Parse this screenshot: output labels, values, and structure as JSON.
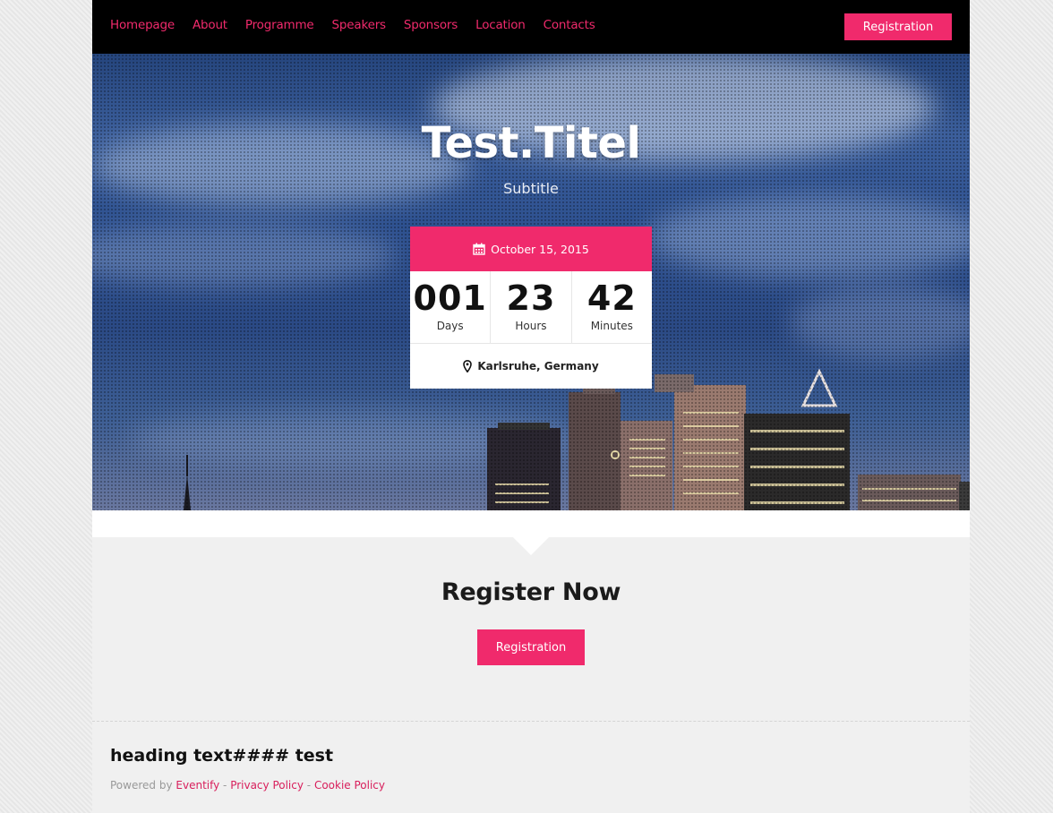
{
  "colors": {
    "accent": "#f02a6c",
    "nav_bg": "#000000"
  },
  "nav": {
    "links": [
      "Homepage",
      "About",
      "Programme",
      "Speakers",
      "Sponsors",
      "Location",
      "Contacts"
    ],
    "registration_label": "Registration"
  },
  "hero": {
    "title": "Test.Titel",
    "subtitle": "Subtitle"
  },
  "countdown": {
    "date_icon": "calendar-icon",
    "date": "October 15, 2015",
    "units": [
      {
        "value": "001",
        "label": "Days"
      },
      {
        "value": "23",
        "label": "Hours"
      },
      {
        "value": "42",
        "label": "Minutes"
      }
    ],
    "location_icon": "map-marker-icon",
    "location": "Karlsruhe, Germany"
  },
  "register": {
    "title": "Register Now",
    "button_label": "Registration"
  },
  "footer": {
    "heading": "heading text#### test",
    "powered_by": "Powered by",
    "brand": "Eventify",
    "sep1": " - ",
    "privacy": "Privacy Policy",
    "sep2": " - ",
    "cookie": "Cookie Policy"
  }
}
